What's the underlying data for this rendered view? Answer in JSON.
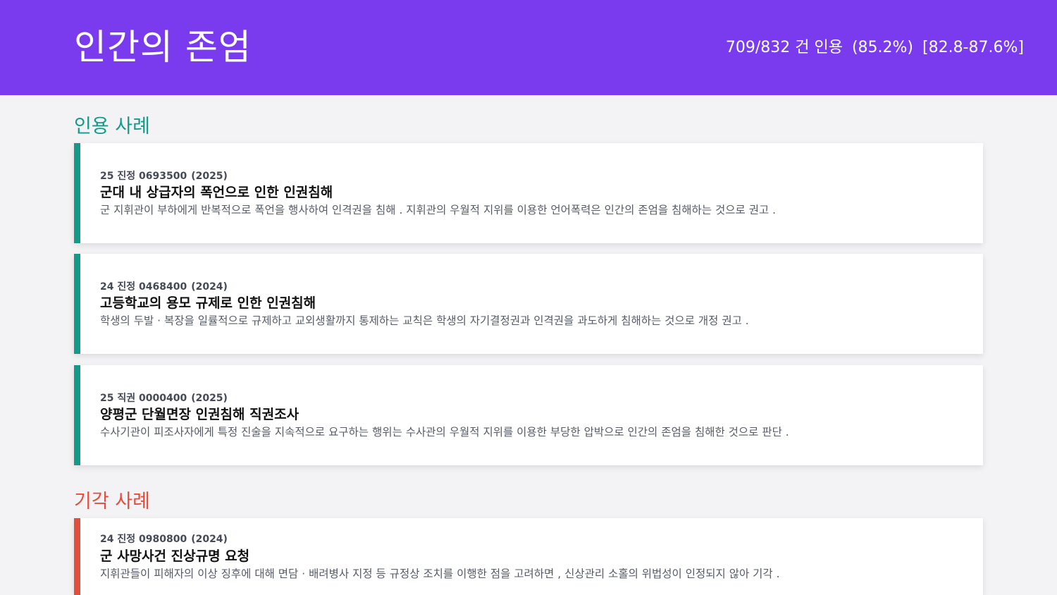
{
  "header": {
    "title": "인간의 존엄",
    "count": "709/832 건 인용",
    "percent": "(85.2%)",
    "range": "[82.8-87.6%]"
  },
  "sections": {
    "accepted_label": "인용 사례",
    "rejected_label": "기각 사례"
  },
  "accepted_cases": [
    {
      "id": "25 진정 0693500",
      "year": "(2025)",
      "title": "군대 내 상급자의 폭언으로 인한 인권침해",
      "desc": "군 지휘관이 부하에게 반복적으로 폭언을 행사하여 인격권을 침해 .  지휘관의 우월적 지위를 이용한 언어폭력은 인간의 존엄을 침해하는 것으로 권고 ."
    },
    {
      "id": "24 진정 0468400",
      "year": "(2024)",
      "title": "고등학교의 용모 규제로 인한 인권침해",
      "desc": "학생의 두발 · 복장을 일률적으로 규제하고 교외생활까지 통제하는 교칙은 학생의 자기결정권과 인격권을 과도하게 침해하는 것으로 개정 권고 ."
    },
    {
      "id": "25 직권 0000400",
      "year": "(2025)",
      "title": "양평군 단월면장 인권침해 직권조사",
      "desc": "수사기관이 피조사자에게 특정 진술을 지속적으로 요구하는 행위는 수사관의 우월적 지위를 이용한 부당한 압박으로 인간의 존엄을 침해한 것으로 판단 ."
    }
  ],
  "rejected_cases": [
    {
      "id": "24 진정 0980800",
      "year": "(2024)",
      "title": "군 사망사건 진상규명 요청",
      "desc": "지휘관들이 피해자의 이상 징후에 대해 면담 · 배려병사 지정 등 규정상 조치를 이행한 점을 고려하면 ,  신상관리 소홀의 위법성이 인정되지 않아 기각 ."
    }
  ],
  "colors": {
    "header_bg": "#7a3bef",
    "accepted": "#159a8a",
    "rejected": "#e14e3c"
  }
}
